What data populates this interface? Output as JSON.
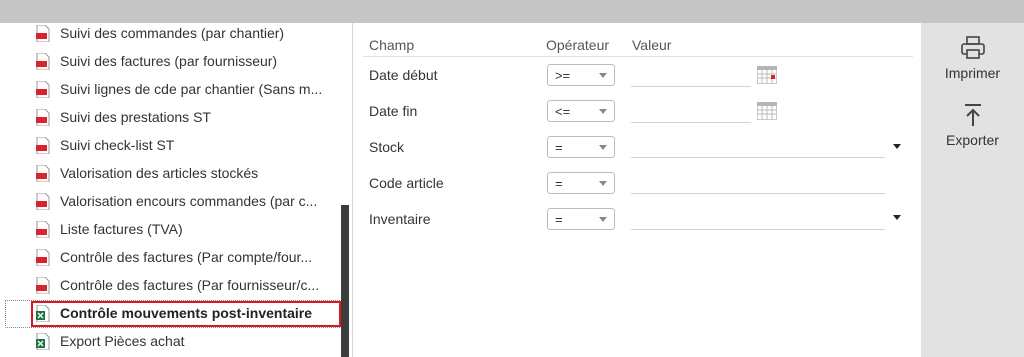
{
  "report_list": {
    "items": [
      {
        "label": "Suivi des commandes (par chantier)",
        "type": "pdf"
      },
      {
        "label": "Suivi des factures (par fournisseur)",
        "type": "pdf"
      },
      {
        "label": "Suivi lignes de cde par chantier (Sans m...",
        "type": "pdf"
      },
      {
        "label": "Suivi des prestations ST",
        "type": "pdf"
      },
      {
        "label": "Suivi check-list ST",
        "type": "pdf"
      },
      {
        "label": "Valorisation des articles stockés",
        "type": "pdf"
      },
      {
        "label": "Valorisation encours commandes (par c...",
        "type": "pdf"
      },
      {
        "label": "Liste factures (TVA)",
        "type": "pdf"
      },
      {
        "label": "Contrôle des factures (Par compte/four...",
        "type": "pdf"
      },
      {
        "label": "Contrôle des factures (Par fournisseur/c...",
        "type": "pdf"
      },
      {
        "label": "Contrôle mouvements post-inventaire",
        "type": "excel",
        "selected": true
      },
      {
        "label": "Export Pièces achat",
        "type": "excel"
      }
    ]
  },
  "filters": {
    "headers": {
      "field": "Champ",
      "operator": "Opérateur",
      "value": "Valeur"
    },
    "rows": [
      {
        "label": "Date début",
        "operator": ">=",
        "value": "",
        "value_widget": "calendar-icon"
      },
      {
        "label": "Date fin",
        "operator": "<=",
        "value": "",
        "value_widget": "calendar-icon"
      },
      {
        "label": "Stock",
        "operator": "=",
        "value": "",
        "value_widget": "dropdown"
      },
      {
        "label": "Code article",
        "operator": "=",
        "value": "",
        "value_widget": "text"
      },
      {
        "label": "Inventaire",
        "operator": "=",
        "value": "",
        "value_widget": "dropdown"
      }
    ]
  },
  "actions": {
    "print_label": "Imprimer",
    "export_label": "Exporter"
  },
  "colors": {
    "selection_border": "#e0161e",
    "pdf_icon": "#d9232d",
    "excel_icon": "#1f7244",
    "sidebar_bg": "#e2e2e2",
    "topbar_bg": "#c6c6c6"
  }
}
